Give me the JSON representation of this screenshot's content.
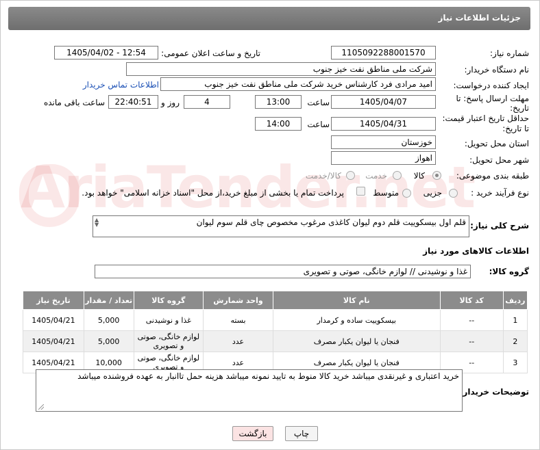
{
  "header": {
    "title": "جزئیات اطلاعات نیاز"
  },
  "form": {
    "need_number_label": "شماره نیاز:",
    "need_number": "1105092288001570",
    "announce_label": "تاریخ و ساعت اعلان عمومی:",
    "announce_value": "1405/04/02 - 12:54",
    "buyer_label": "نام دستگاه خریدار:",
    "buyer_value": "شرکت ملی مناطق نفت خیز جنوب",
    "creator_label": "ایجاد کننده درخواست:",
    "creator_value": "امید مرادی فرد کارشناس خرید شرکت ملی مناطق نفت خیز جنوب",
    "contact_link": "اطلاعات تماس خریدار",
    "deadline_label_1": "مهلت ارسال پاسخ: تا",
    "deadline_label_2": "تاریخ:",
    "deadline_date": "1405/04/07",
    "time_label": "ساعت",
    "deadline_time": "13:00",
    "days_value": "4",
    "days_label": "روز و",
    "remaining_time": "22:40:51",
    "remaining_label": "ساعت باقی مانده",
    "validity_label_1": "حداقل تاریخ اعتبار قیمت:",
    "validity_label_2": "تا تاریخ:",
    "validity_date": "1405/04/31",
    "validity_time_label": "ساعت",
    "validity_time": "14:00",
    "province_label": "استان محل تحویل:",
    "province_value": "خوزستان",
    "city_label": "شهر محل تحویل:",
    "city_value": "اهواز",
    "category_label": "طبقه بندی موضوعی:",
    "category_options": [
      "کالا",
      "خدمت",
      "کالا/خدمت"
    ],
    "process_label": "نوع فرآیند خرید :",
    "process_options": [
      "جزیی",
      "متوسط"
    ],
    "payment_note": "پرداخت تمام یا بخشی از مبلغ خرید،از محل \"اسناد خزانه اسلامی\" خواهد بود.",
    "description_label": "شرح کلی نیاز:",
    "description_value": "قلم اول بیسکوییت قلم دوم لیوان کاغذی مرغوب مخصوص چای قلم سوم لیوان",
    "goods_info_title": "اطلاعات کالاهای مورد نیاز",
    "goods_group_label": "گروه کالا:",
    "goods_group_value": "غذا و نوشیدنی // لوازم خانگی، صوتی و تصویری"
  },
  "table": {
    "headers": [
      "ردیف",
      "کد کالا",
      "نام کالا",
      "واحد شمارش",
      "گروه کالا",
      "تعداد / مقدار",
      "تاریخ نیاز"
    ],
    "rows": [
      [
        "1",
        "--",
        "بیسکوییت ساده و کرمدار",
        "بسته",
        "غذا و نوشیدنی",
        "5,000",
        "1405/04/21"
      ],
      [
        "2",
        "--",
        "فنجان یا لیوان یکبار مصرف",
        "عدد",
        "لوازم خانگی، صوتی و تصویری",
        "5,000",
        "1405/04/21"
      ],
      [
        "3",
        "--",
        "فنجان یا لیوان یکبار مصرف",
        "عدد",
        "لوازم خانگی، صوتی و تصویری",
        "10,000",
        "1405/04/21"
      ]
    ]
  },
  "buyer_notes": {
    "label": "توضیحات خریدار:",
    "value": "خرید اعتباری و غیرنقدی میباشد خرید کالا منوط به تایید نمونه میباشد هزینه حمل تاانبار به عهده فروشنده میباشد"
  },
  "buttons": {
    "print": "چاپ",
    "back": "بازگشت"
  },
  "watermark": "AriaTender.net"
}
